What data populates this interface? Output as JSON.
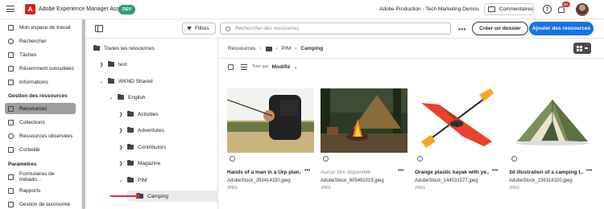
{
  "app": {
    "title": "Adobe Experience Manager Assets",
    "env": "DEV",
    "org": "Adobe Production - Tech Marketing Demos",
    "comments_label": "Commentaires",
    "notification_count": "9+"
  },
  "sidebar": {
    "items_top": [
      {
        "label": "Mon espace de travail",
        "icon": "home-icon"
      },
      {
        "label": "Rechercher",
        "icon": "search-icon"
      },
      {
        "label": "Tâches",
        "icon": "tasks-icon"
      },
      {
        "label": "Récemment consultées",
        "icon": "clock-icon"
      },
      {
        "label": "Informations",
        "icon": "insights-icon"
      }
    ],
    "section1": "Gestion des ressources",
    "items_mid": [
      {
        "label": "Ressources",
        "icon": "assets-icon",
        "active": true
      },
      {
        "label": "Collections",
        "icon": "collections-icon"
      },
      {
        "label": "Ressources observées",
        "icon": "watch-icon"
      },
      {
        "label": "Corbeille",
        "icon": "trash-icon"
      }
    ],
    "section2": "Paramètres",
    "items_bottom": [
      {
        "label": "Formulaires de métado...",
        "icon": "form-icon"
      },
      {
        "label": "Rapports",
        "icon": "reports-icon"
      },
      {
        "label": "Gestion de taxonomie",
        "icon": "taxonomy-icon"
      }
    ]
  },
  "toolbar": {
    "filters_label": "Filtres",
    "search_placeholder": "Rechercher des ressources",
    "create_folder": "Créer un dossier",
    "add_assets": "Ajouter des ressources"
  },
  "tree": {
    "root": "Toutes les ressources",
    "nodes": [
      "test",
      "WKND Shared",
      "English",
      "Activities",
      "Adventures",
      "Contributors",
      "Magazine",
      "PIM",
      "Camping"
    ]
  },
  "breadcrumb": {
    "root": "Ressources",
    "mid": "PIM",
    "current": "Camping"
  },
  "sort": {
    "label": "Trier par",
    "value": "Modifié"
  },
  "cards": [
    {
      "title": "Hands of a man in a Urp plan...",
      "file": "AdobeStock_293414330.jpeg",
      "type": "JPEG",
      "untitled": false
    },
    {
      "title": "Aucun titre disponible",
      "file": "AdobeStock_605492019.jpeg",
      "type": "JPEG",
      "untitled": true
    },
    {
      "title": "Orange plastic kayak with ye...",
      "file": "AdobeStock_144531577.jpeg",
      "type": "JPEG",
      "untitled": false
    },
    {
      "title": "3d illustration of a camping t...",
      "file": "AdobeStock_236318320.jpeg",
      "type": "JPEG",
      "untitled": false
    }
  ]
}
